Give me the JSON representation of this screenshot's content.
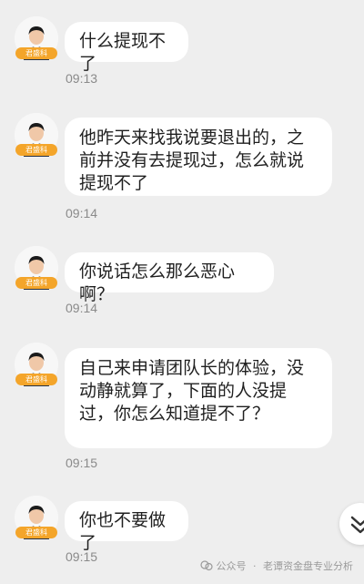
{
  "app": {
    "avatar_badge": "君盛科",
    "watermark": {
      "icon": "wechat-official-account-icon",
      "source": "公众号",
      "separator": "·",
      "author": "老谭资金盘专业分析"
    },
    "scroll_button_icon": "double-chevron-down-icon"
  },
  "messages": [
    {
      "text": "什么提现不了",
      "time": "09:13"
    },
    {
      "text": "他昨天来找我说要退出的，之前并没有去提现过，怎么就说提现不了",
      "time": "09:14"
    },
    {
      "text": "你说话怎么那么恶心啊？",
      "time": "09:14"
    },
    {
      "text": "自己来申请团队长的体验，没动静就算了，下面的人没提过，你怎么知道提不了？",
      "time": "09:15"
    },
    {
      "text": "你也不要做了",
      "time": "09:15"
    }
  ]
}
